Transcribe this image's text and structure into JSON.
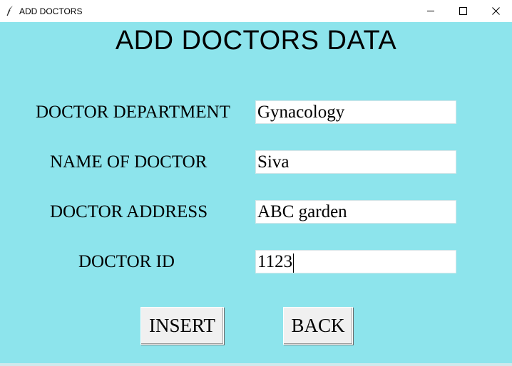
{
  "window": {
    "title": "ADD DOCTORS",
    "icon": "feather-icon",
    "controls": [
      "minimize",
      "maximize",
      "close"
    ]
  },
  "heading": "ADD DOCTORS DATA",
  "form": {
    "department": {
      "label": "DOCTOR DEPARTMENT",
      "value": "Gynacology"
    },
    "name": {
      "label": "NAME OF DOCTOR",
      "value": "Siva"
    },
    "address": {
      "label": "DOCTOR ADDRESS",
      "value": "ABC garden"
    },
    "id": {
      "label": "DOCTOR ID",
      "value": "1123"
    }
  },
  "buttons": {
    "insert": "INSERT",
    "back": "BACK"
  },
  "colors": {
    "background": "#8de4ec",
    "field": "#ffffff",
    "button": "#f0f0f0"
  }
}
